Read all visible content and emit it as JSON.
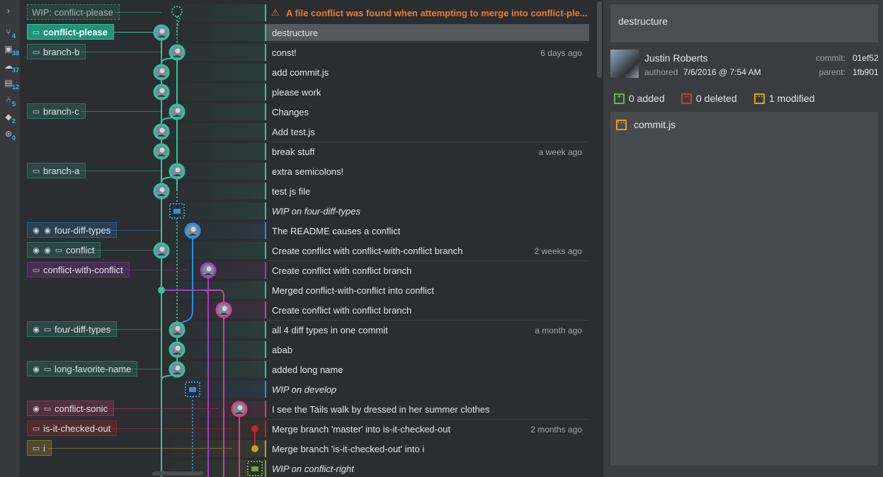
{
  "leftbar": [
    {
      "icon": "chevron-right-icon",
      "glyph": "›",
      "count": ""
    },
    {
      "icon": "local-branch-icon",
      "glyph": "⑂",
      "count": "4"
    },
    {
      "icon": "remote-icon",
      "glyph": "▣",
      "count": "38"
    },
    {
      "icon": "cloud-icon",
      "glyph": "☁",
      "count": "37"
    },
    {
      "icon": "stash-icon",
      "glyph": "▤",
      "count": "12"
    },
    {
      "icon": "pull-request-icon",
      "glyph": "⑃",
      "count": "5"
    },
    {
      "icon": "tag-icon",
      "glyph": "◆",
      "count": "2"
    },
    {
      "icon": "submodule-icon",
      "glyph": "⊛",
      "count": "0"
    }
  ],
  "colors": {
    "teal": "#2ec4a0",
    "blue": "#2a8fe8",
    "purple": "#a33ac4",
    "magenta": "#d63aa8",
    "pink": "#e03a7a",
    "red": "#c02828",
    "olive": "#c0a428",
    "green": "#6aa83a",
    "warn": "#f07c2a"
  },
  "rows": [
    {
      "ref": "WIP: conflict-please",
      "ref_icons": [],
      "ref_style": "wip",
      "msg": "A file conflict was found when attempting to merge into conflict-ple...",
      "style": "warn",
      "when": "",
      "lane": "teal"
    },
    {
      "ref": "conflict-please",
      "ref_icons": [
        "laptop"
      ],
      "ref_style": "active",
      "msg": "destructure",
      "style": "",
      "when": "",
      "lane": "teal",
      "selected": true
    },
    {
      "ref": "branch-b",
      "ref_icons": [
        "laptop"
      ],
      "ref_style": "teal",
      "msg": "const!",
      "style": "",
      "when": "6 days ago",
      "lane": "teal"
    },
    {
      "ref": "",
      "ref_icons": [],
      "msg": "add commit.js",
      "style": "",
      "when": "",
      "lane": "teal"
    },
    {
      "ref": "",
      "ref_icons": [],
      "msg": "please work",
      "style": "",
      "when": "",
      "lane": "teal"
    },
    {
      "ref": "branch-c",
      "ref_icons": [
        "laptop"
      ],
      "ref_style": "teal",
      "msg": "Changes",
      "style": "",
      "when": "",
      "lane": "teal"
    },
    {
      "ref": "",
      "ref_icons": [],
      "msg": "Add test.js",
      "style": "",
      "when": "",
      "lane": "teal"
    },
    {
      "ref": "",
      "ref_icons": [],
      "msg": "break stuff",
      "style": "",
      "when": "a week ago",
      "lane": "teal"
    },
    {
      "ref": "branch-a",
      "ref_icons": [
        "laptop"
      ],
      "ref_style": "teal",
      "msg": "extra semicolons!",
      "style": "",
      "when": "",
      "lane": "teal"
    },
    {
      "ref": "",
      "ref_icons": [],
      "msg": "test js file",
      "style": "",
      "when": "",
      "lane": "teal"
    },
    {
      "ref": "",
      "ref_icons": [],
      "msg": "WIP on four-diff-types",
      "style": "italic",
      "when": "",
      "lane": "teal"
    },
    {
      "ref": "four-diff-types",
      "ref_icons": [
        "github",
        "github"
      ],
      "ref_style": "blue",
      "msg": "The README causes a conflict",
      "style": "",
      "when": "",
      "lane": "blue"
    },
    {
      "ref": "conflict",
      "ref_icons": [
        "github",
        "github",
        "laptop"
      ],
      "ref_style": "teal",
      "msg": "Create conflict with conflict-with-conflict branch",
      "style": "",
      "when": "2 weeks ago",
      "lane": "teal"
    },
    {
      "ref": "conflict-with-conflict",
      "ref_icons": [
        "laptop"
      ],
      "ref_style": "purple",
      "msg": "Create conflict with conflict branch",
      "style": "",
      "when": "",
      "lane": "purple"
    },
    {
      "ref": "",
      "ref_icons": [],
      "msg": "Merged conflict-with-conflict into conflict",
      "style": "",
      "when": "",
      "lane": "teal"
    },
    {
      "ref": "",
      "ref_icons": [],
      "msg": "Create conflict with conflict branch",
      "style": "",
      "when": "",
      "lane": "magenta"
    },
    {
      "ref": "four-diff-types",
      "ref_icons": [
        "github",
        "laptop"
      ],
      "ref_style": "teal",
      "msg": "all 4 diff types in one commit",
      "style": "",
      "when": "a month ago",
      "lane": "teal"
    },
    {
      "ref": "",
      "ref_icons": [],
      "msg": "abab",
      "style": "",
      "when": "",
      "lane": "teal"
    },
    {
      "ref": "long-favorite-name",
      "ref_icons": [
        "github",
        "laptop"
      ],
      "ref_style": "teal",
      "msg": "added long name",
      "style": "",
      "when": "",
      "lane": "teal"
    },
    {
      "ref": "",
      "ref_icons": [],
      "msg": "WIP on develop",
      "style": "italic",
      "when": "",
      "lane": "blue"
    },
    {
      "ref": "conflict-sonic",
      "ref_icons": [
        "github",
        "laptop"
      ],
      "ref_style": "pink",
      "msg": "I see the Tails walk by dressed in her summer clothes",
      "style": "",
      "when": "",
      "lane": "pink"
    },
    {
      "ref": "is-it-checked-out",
      "ref_icons": [
        "laptop"
      ],
      "ref_style": "red",
      "msg": "Merge branch 'master' into is-it-checked-out",
      "style": "",
      "when": "2 months ago",
      "lane": "red"
    },
    {
      "ref": "i",
      "ref_icons": [
        "laptop"
      ],
      "ref_style": "olive",
      "msg": "Merge branch 'is-it-checked-out' into i",
      "style": "",
      "when": "",
      "lane": "olive"
    },
    {
      "ref": "",
      "ref_icons": [],
      "msg": "WIP on conflict-right",
      "style": "italic",
      "when": "",
      "lane": "green"
    }
  ],
  "detail": {
    "summary": "destructure",
    "author": "Justin Roberts",
    "authored_label": "authored",
    "authored_date": "7/6/2016 @ 7:54 AM",
    "commit_label": "commit:",
    "commit_sha": "01ef52",
    "parent_label": "parent:",
    "parent_sha": "1fb901",
    "added": "0 added",
    "deleted": "0 deleted",
    "modified": "1 modified",
    "files": [
      {
        "name": "commit.js",
        "status": "modified"
      }
    ]
  }
}
